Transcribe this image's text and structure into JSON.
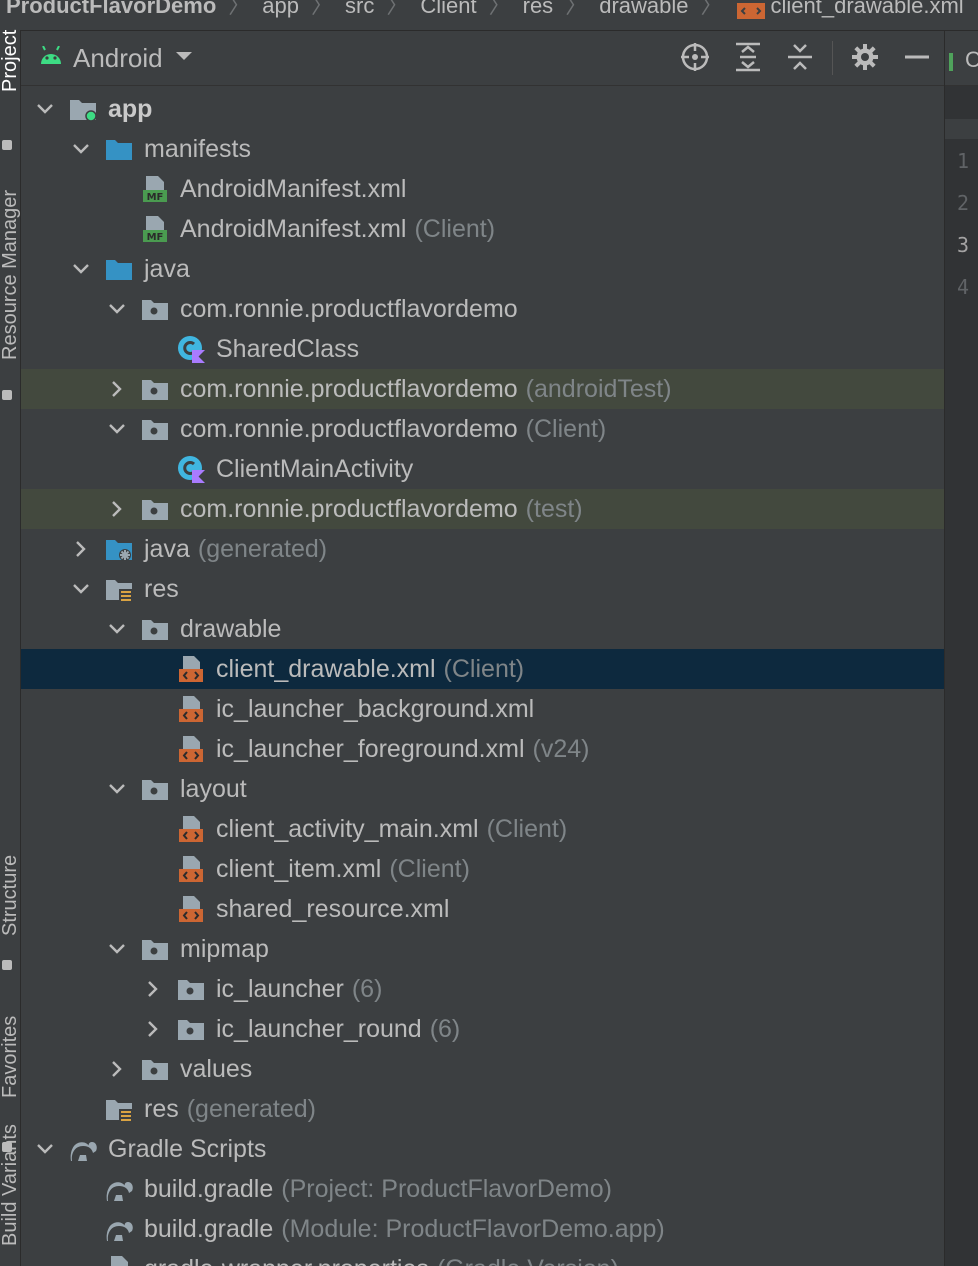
{
  "breadcrumb": {
    "items": [
      "ProductFlavorDemo",
      "app",
      "src",
      "Client",
      "res",
      "drawable",
      "client_drawable.xml"
    ]
  },
  "left_strip": {
    "tabs": [
      "Project",
      "Resource Manager",
      "Structure",
      "Favorites",
      "Build Variants"
    ]
  },
  "panel": {
    "view_selector": "Android",
    "buttons": [
      "target-icon",
      "expand-all-icon",
      "collapse-all-icon",
      "gear-icon",
      "minimize-icon"
    ]
  },
  "tree": [
    {
      "depth": 0,
      "chevron": "down",
      "icon": "module-folder",
      "name": "app",
      "note": "",
      "bold": true
    },
    {
      "depth": 1,
      "chevron": "down",
      "icon": "blue-folder",
      "name": "manifests",
      "note": ""
    },
    {
      "depth": 2,
      "chevron": "none",
      "icon": "manifest-file",
      "name": "AndroidManifest.xml",
      "note": ""
    },
    {
      "depth": 2,
      "chevron": "none",
      "icon": "manifest-file",
      "name": "AndroidManifest.xml",
      "note": "(Client)"
    },
    {
      "depth": 1,
      "chevron": "down",
      "icon": "blue-folder",
      "name": "java",
      "note": ""
    },
    {
      "depth": 2,
      "chevron": "down",
      "icon": "package-folder",
      "name": "com.ronnie.productflavordemo",
      "note": ""
    },
    {
      "depth": 3,
      "chevron": "none",
      "icon": "kotlin-class",
      "name": "SharedClass",
      "note": ""
    },
    {
      "depth": 2,
      "chevron": "right",
      "icon": "package-folder",
      "name": "com.ronnie.productflavordemo",
      "note": "(androidTest)",
      "highlight": "green"
    },
    {
      "depth": 2,
      "chevron": "down",
      "icon": "package-folder",
      "name": "com.ronnie.productflavordemo",
      "note": "(Client)"
    },
    {
      "depth": 3,
      "chevron": "none",
      "icon": "kotlin-class",
      "name": "ClientMainActivity",
      "note": ""
    },
    {
      "depth": 2,
      "chevron": "right",
      "icon": "package-folder",
      "name": "com.ronnie.productflavordemo",
      "note": "(test)",
      "highlight": "green"
    },
    {
      "depth": 1,
      "chevron": "right",
      "icon": "generated-folder",
      "name": "java",
      "note": "(generated)"
    },
    {
      "depth": 1,
      "chevron": "down",
      "icon": "res-folder",
      "name": "res",
      "note": ""
    },
    {
      "depth": 2,
      "chevron": "down",
      "icon": "package-folder",
      "name": "drawable",
      "note": ""
    },
    {
      "depth": 3,
      "chevron": "none",
      "icon": "xml-file",
      "name": "client_drawable.xml",
      "note": "(Client)",
      "highlight": "selected"
    },
    {
      "depth": 3,
      "chevron": "none",
      "icon": "xml-file",
      "name": "ic_launcher_background.xml",
      "note": ""
    },
    {
      "depth": 3,
      "chevron": "none",
      "icon": "xml-file",
      "name": "ic_launcher_foreground.xml",
      "note": "(v24)"
    },
    {
      "depth": 2,
      "chevron": "down",
      "icon": "package-folder",
      "name": "layout",
      "note": ""
    },
    {
      "depth": 3,
      "chevron": "none",
      "icon": "xml-file",
      "name": "client_activity_main.xml",
      "note": "(Client)"
    },
    {
      "depth": 3,
      "chevron": "none",
      "icon": "xml-file",
      "name": "client_item.xml",
      "note": "(Client)"
    },
    {
      "depth": 3,
      "chevron": "none",
      "icon": "xml-file",
      "name": "shared_resource.xml",
      "note": ""
    },
    {
      "depth": 2,
      "chevron": "down",
      "icon": "package-folder",
      "name": "mipmap",
      "note": ""
    },
    {
      "depth": 3,
      "chevron": "right",
      "icon": "package-folder",
      "name": "ic_launcher",
      "note": "(6)"
    },
    {
      "depth": 3,
      "chevron": "right",
      "icon": "package-folder",
      "name": "ic_launcher_round",
      "note": "(6)"
    },
    {
      "depth": 2,
      "chevron": "right",
      "icon": "package-folder",
      "name": "values",
      "note": ""
    },
    {
      "depth": 1,
      "chevron": "none",
      "icon": "res-folder",
      "name": "res",
      "note": "(generated)"
    },
    {
      "depth": 0,
      "chevron": "down",
      "icon": "gradle",
      "name": "Gradle Scripts",
      "note": ""
    },
    {
      "depth": 1,
      "chevron": "none",
      "icon": "gradle",
      "name": "build.gradle",
      "note": "(Project: ProductFlavorDemo)"
    },
    {
      "depth": 1,
      "chevron": "none",
      "icon": "gradle",
      "name": "build.gradle",
      "note": "(Module: ProductFlavorDemo.app)"
    },
    {
      "depth": 1,
      "chevron": "none",
      "icon": "properties-file",
      "name": "gradle-wrapper.properties",
      "note": "(Gradle Version)"
    }
  ],
  "editor": {
    "tab_label": "C",
    "line_numbers": [
      "1",
      "2",
      "3",
      "4"
    ],
    "current_line": "3"
  },
  "colors": {
    "background": "#3c3f41",
    "selection": "#0d293e",
    "green_highlight": "#43493e",
    "text": "#bbbbbb",
    "note": "#7f8588",
    "folder_blue": "#3592c4",
    "xml_orange": "#cc6633",
    "manifest_green": "#4a9b50",
    "kotlin_teal": "#40b6e0",
    "android_green": "#3ddc84"
  }
}
